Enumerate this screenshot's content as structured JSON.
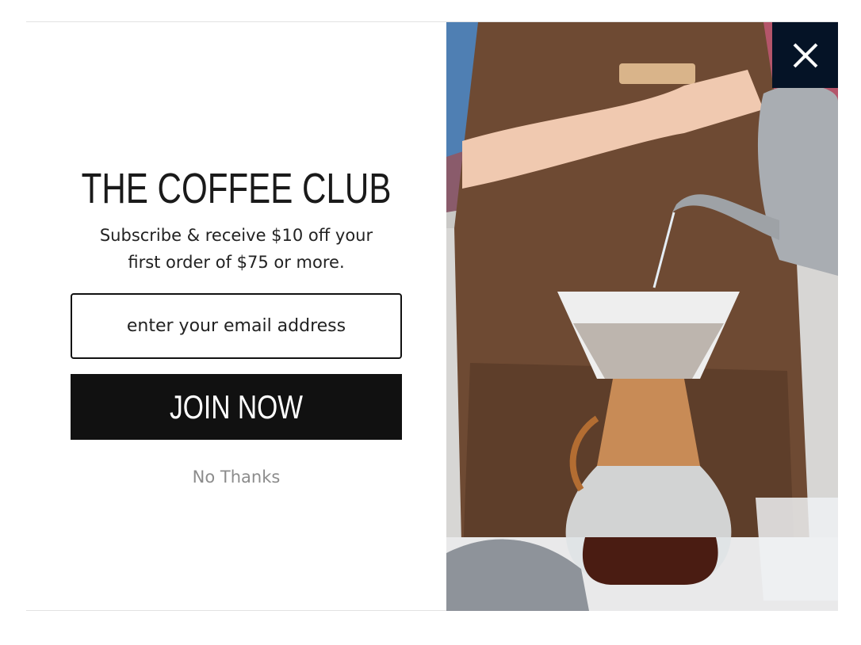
{
  "popup": {
    "title": "THE COFFEE CLUB",
    "subtitle": "Subscribe & receive $10 off your first order of $75 or more.",
    "email_placeholder": "enter your email address",
    "join_label": "JOIN NOW",
    "dismiss_label": "No Thanks"
  },
  "icons": {
    "close": "close-icon"
  },
  "colors": {
    "button_bg": "#111111",
    "close_bg": "#051326",
    "dismiss_text": "#8c8c8c"
  }
}
